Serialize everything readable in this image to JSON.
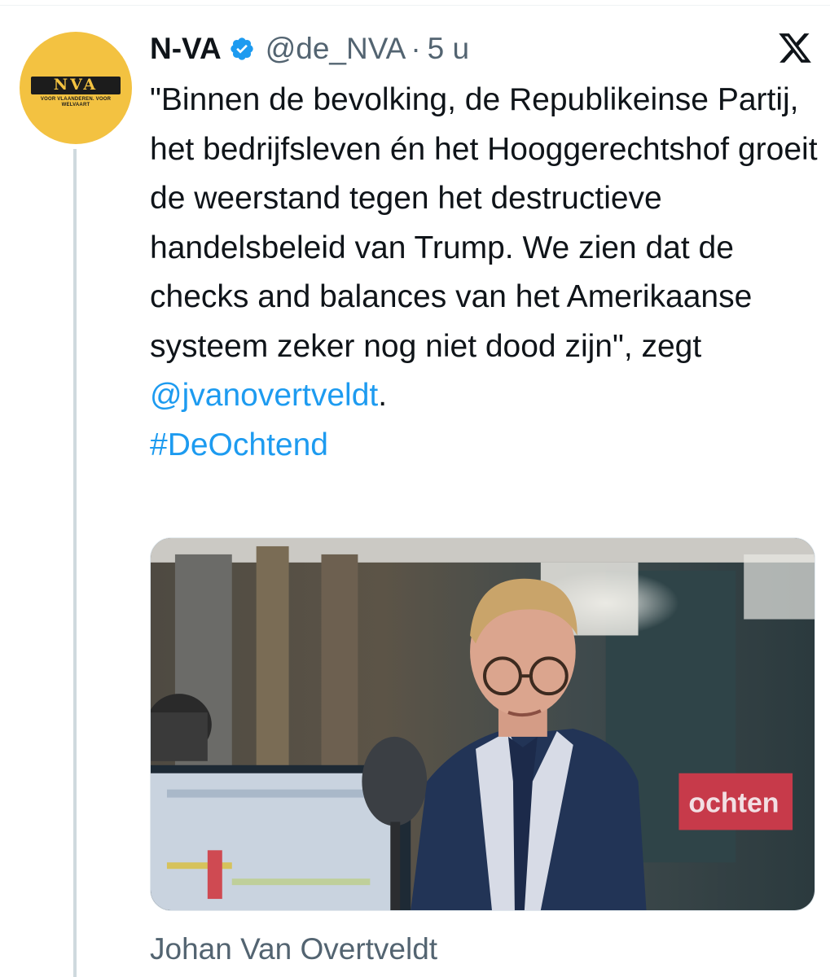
{
  "author": {
    "display_name": "N-VA",
    "handle": "@de_NVA",
    "separator": "·",
    "timestamp": "5 u",
    "verified": true,
    "avatar": {
      "logo_text": "NVA",
      "logo_subtext": "VOOR VLAANDEREN. VOOR WELVAART",
      "background": "#f3c241"
    }
  },
  "tweet": {
    "text_main": "\"Binnen de bevolking, de Republikeinse Partij, het bedrijfsleven én het Hooggerechtshof groeit de weerstand tegen het destructieve handelsbeleid van Trump. We zien dat de checks and balances van het Amerikaanse systeem zeker nog niet dood zijn\", zegt ",
    "mention": "@jvanovertveldt",
    "after_mention": ".",
    "hashtag": "#DeOchtend"
  },
  "media": {
    "radio_sign_text": "ochten",
    "caption": "Johan Van Overtveldt"
  },
  "colors": {
    "link": "#1d9bf0",
    "secondary_text": "#536471",
    "verified_badge": "#1d9bf0",
    "thread_line": "#cfd9de"
  },
  "icons": {
    "x_logo": "x-logo-icon",
    "verified": "verified-badge-icon"
  }
}
